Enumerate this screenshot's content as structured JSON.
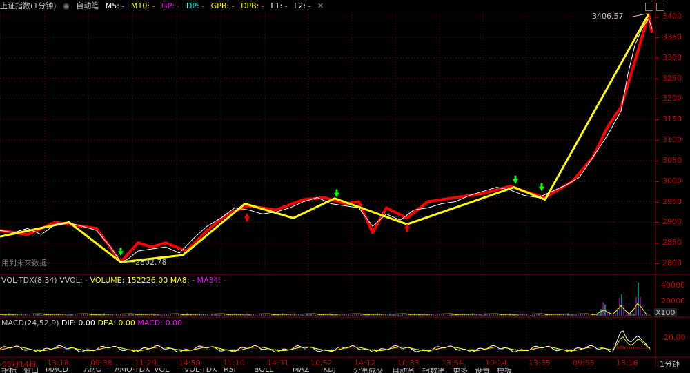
{
  "header": {
    "title": "上证指数(1分钟)",
    "indicator": "自动笔",
    "m5": "M5: -",
    "m10": "M10: -",
    "gp": "GP: -",
    "dp": "DP: -",
    "gpb": "GPB: -",
    "dpb": "DPB: -",
    "l1": "L1: -",
    "l2": "L2: -"
  },
  "notes": {
    "future_data": "用到未来数据",
    "high_label": "3406.57",
    "low_label": "2802.78",
    "period_label": "1分钟",
    "x100": "X100"
  },
  "volume_panel": {
    "name": "VOL-TDX(8,34)",
    "vvol": "VVOL: -",
    "volume": "VOLUME: 152226.00",
    "ma8": "MA8: -",
    "ma34": "MA34: -",
    "ticks": [
      "40000",
      "20000"
    ]
  },
  "macd_panel": {
    "name": "MACD(24,52,9)",
    "dif": "DIF: 0.00",
    "dea": "DEA: 0.00",
    "macd": "MACD: 0.00",
    "ticks": [
      "20.00"
    ]
  },
  "time_axis": [
    "05月14日",
    "13:18",
    "09:38",
    "11:29",
    "14:50",
    "11:10",
    "14:31",
    "10:52",
    "14:12",
    "10:33",
    "13:54",
    "10:14",
    "13:35",
    "09:55",
    "13:16"
  ],
  "bottom_tabs": [
    "指标",
    "窗口",
    "MACD",
    "AMO",
    "AMO-TDX",
    "VOL",
    "VOL-TDX",
    "RSI",
    "BOLL",
    "MAZ",
    "KDJ",
    "分笔成交",
    "自动笔",
    "指数笔",
    "更多",
    "设置",
    "模板"
  ],
  "colors": {
    "price_line": "#ffffff",
    "bi_red": "#ff0000",
    "bi_yellow": "#ffff00",
    "arrow_down": "#00ff00",
    "arrow_up": "#ff0000",
    "grid": "#800000",
    "axis_text": "#d00000",
    "magenta": "#ff00ff",
    "cyan": "#00ffff"
  },
  "chart_data": {
    "type": "line",
    "title": "上证指数(1分钟)",
    "ylim": [
      2780,
      3420
    ],
    "yticks": [
      2800,
      2850,
      2900,
      2950,
      3000,
      3050,
      3100,
      3150,
      3200,
      3250,
      3300,
      3350,
      3400
    ],
    "x_labels": [
      "05月14日",
      "13:18",
      "09:38",
      "11:29",
      "14:50",
      "11:10",
      "14:31",
      "10:52",
      "14:12",
      "10:33",
      "13:54",
      "10:14",
      "13:35",
      "09:55",
      "13:16"
    ],
    "series": [
      {
        "name": "price",
        "x": [
          0,
          20,
          40,
          60,
          80,
          100,
          120,
          140,
          160,
          175,
          185,
          200,
          220,
          240,
          260,
          280,
          300,
          320,
          340,
          360,
          380,
          400,
          420,
          440,
          460,
          480,
          500,
          520,
          540,
          560,
          580,
          600,
          620,
          640,
          660,
          680,
          700,
          720,
          740,
          760,
          780,
          800,
          820,
          840,
          860,
          880,
          900,
          910,
          920,
          930,
          940,
          945
        ],
        "values": [
          2880,
          2875,
          2885,
          2870,
          2895,
          2898,
          2890,
          2880,
          2840,
          2803,
          2810,
          2830,
          2835,
          2840,
          2825,
          2860,
          2890,
          2910,
          2935,
          2930,
          2920,
          2925,
          2935,
          2950,
          2960,
          2945,
          2940,
          2935,
          2890,
          2920,
          2905,
          2930,
          2935,
          2945,
          2950,
          2965,
          2975,
          2985,
          2978,
          2965,
          2960,
          2975,
          2990,
          3010,
          3060,
          3110,
          3170,
          3260,
          3330,
          3370,
          3395,
          3370
        ]
      }
    ],
    "bi_red": {
      "x": [
        0,
        40,
        80,
        100,
        140,
        175,
        200,
        220,
        240,
        270,
        300,
        330,
        360,
        400,
        440,
        470,
        500,
        520,
        540,
        560,
        590,
        620,
        660,
        700,
        740,
        760,
        790,
        830,
        860,
        880,
        900,
        920,
        940,
        945
      ],
      "values": [
        2880,
        2870,
        2900,
        2895,
        2885,
        2803,
        2850,
        2840,
        2850,
        2830,
        2880,
        2920,
        2940,
        2930,
        2955,
        2960,
        2945,
        2950,
        2875,
        2935,
        2910,
        2950,
        2960,
        2970,
        2988,
        2975,
        2960,
        3000,
        3060,
        3130,
        3180,
        3290,
        3405,
        3360
      ]
    },
    "bi_yellow": {
      "x": [
        0,
        100,
        175,
        265,
        355,
        425,
        485,
        590,
        745,
        790,
        940
      ],
      "values": [
        2865,
        2900,
        2803,
        2820,
        2945,
        2910,
        2958,
        2895,
        2985,
        2955,
        3406
      ]
    },
    "markers_down": [
      175,
      488,
      747,
      785
    ],
    "markers_up": [
      358,
      590
    ],
    "annotations": [
      {
        "text": "3406.57",
        "x": 940,
        "y": 3406.57
      },
      {
        "text": "2802.78",
        "x": 178,
        "y": 2802.78
      }
    ]
  },
  "volume_data": {
    "type": "bar",
    "ylim": [
      0,
      45000
    ],
    "spikes": [
      {
        "x": 875,
        "v": 20000
      },
      {
        "x": 900,
        "v": 32000
      },
      {
        "x": 925,
        "v": 42000
      }
    ]
  },
  "macd_data": {
    "type": "line",
    "ylim": [
      -10,
      30
    ],
    "spikes": [
      {
        "x": 902,
        "v": 25
      },
      {
        "x": 925,
        "v": 15
      }
    ]
  }
}
